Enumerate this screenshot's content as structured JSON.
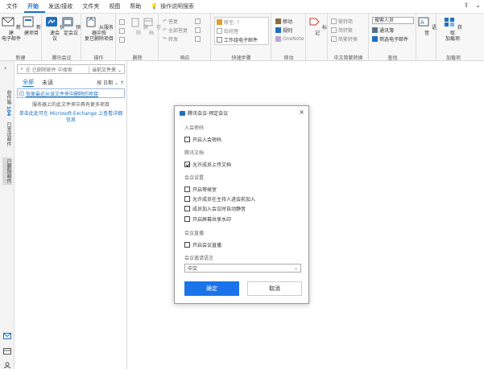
{
  "menu": {
    "items": [
      "文件",
      "开始",
      "发送/接收",
      "文件夹",
      "视图",
      "帮助"
    ],
    "active_index": 1,
    "tell_me": "操作说明搜索"
  },
  "ribbon": {
    "new_group": {
      "label": "新建",
      "new_email": "新建\n电子邮件",
      "new_items": "新建项目"
    },
    "tencent_group": {
      "label": "腾讯会议",
      "quick_meeting": "快速会\n议",
      "schedule": "预定会议"
    },
    "actions_group": {
      "label": "操作",
      "restore": "从服务器中恢\n复已删除项目"
    },
    "delete_group": {
      "label": "删除",
      "delete": "删除",
      "archive": "存档"
    },
    "respond_group": {
      "label": "响应",
      "reply": "答复",
      "reply_all": "全部答复",
      "forward": "转发"
    },
    "quick_steps": {
      "label": "快速步骤",
      "move_to": "移至: ?",
      "to_manager": "给经理",
      "team_email": "工作组电子邮件"
    },
    "move_group": {
      "label": "移动",
      "move": "移动",
      "rules": "规则",
      "onenote": "OneNote"
    },
    "tags_group": {
      "label": "标记"
    },
    "chinese_convert": {
      "label": "中文简繁转换",
      "to_simplified": "繁转简",
      "to_traditional": "简转繁",
      "simp_trad": "简繁转换"
    },
    "find_group": {
      "label": "查找",
      "search_people": "搜索人员",
      "address_book": "通讯簿",
      "filter_email": "筛选电子邮件"
    },
    "voice": {
      "label": "语音"
    },
    "addins": {
      "label": "加载项",
      "get_addins": "获取\n加载项"
    }
  },
  "nav": {
    "tabs": [
      "收件箱",
      "已发送邮件",
      "已删除邮件"
    ],
    "selected_index": 2,
    "inbox_count": "104"
  },
  "folder_pane": {
    "search_placeholder": "在 已删除邮件 中搜索",
    "search_scope": "当前文件夹",
    "filter_all": "全部",
    "filter_unread": "未读",
    "sort": "按 日期 ⌄  ↑",
    "info_text": "恢复最近从该文件夹中删除的项目",
    "more_items": "服务器上的此文件夹中具有更多项目",
    "exchange_link": "单击此处可在 Microsoft Exchange 上查看详细信息"
  },
  "dialog": {
    "title": "腾讯会议-预定会议",
    "close": "×",
    "sec_password": "入会密码",
    "opt_password": "开启入会密码",
    "sec_docs": "腾讯文档",
    "opt_upload": "允许成员上传文档",
    "sec_meeting": "会议设置",
    "opt_waiting_room": "开启等候室",
    "opt_join_before_host": "允许成员在主持人进会前加入",
    "opt_mute_on_join": "成员加入会议时自动静音",
    "opt_watermark": "开启屏幕共享水印",
    "sec_live": "会议直播",
    "opt_live": "开启会议直播",
    "sec_language": "会议邀请语言",
    "language_value": "中文",
    "ok": "确定",
    "cancel": "取消",
    "checked": {
      "password": false,
      "upload": true,
      "waiting_room": false,
      "join_before_host": false,
      "mute_on_join": false,
      "watermark": false,
      "live": false
    }
  },
  "colors": {
    "accent": "#1f6fbd",
    "ok_button": "#1a73e8",
    "brand_blue": "#1f6fbd"
  }
}
